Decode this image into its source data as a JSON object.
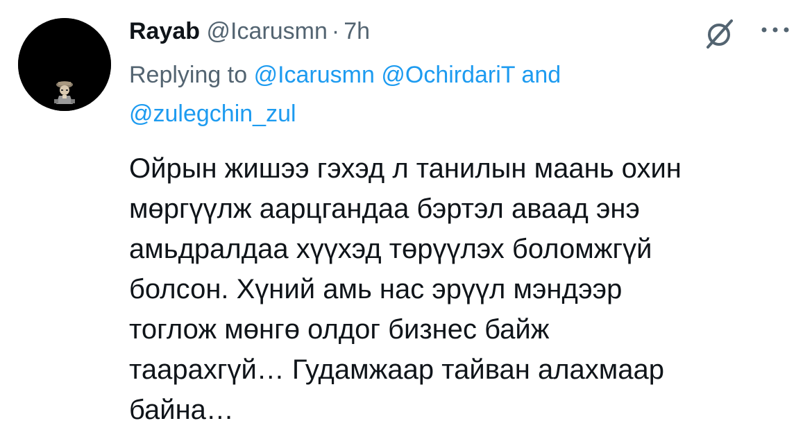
{
  "tweet": {
    "display_name": "Rayab",
    "handle": "@Icarusmn",
    "separator": "·",
    "time": "7h",
    "replying_prefix": "Replying to",
    "mentions": [
      "@Icarusmn",
      "@OchirdariT"
    ],
    "mentions_joiner": "and",
    "last_mention": "@zulegchin_zul",
    "text": "Ойрын жишээ гэхэд л танилын маань охин\nмөргүүлж аарцгандаа бэртэл аваад энэ\nамьдралдаа хүүхэд төрүүлэх боломжгүй\nболсон. Хүний амь нас эрүүл мэндээр\nтоглож мөнгө олдог бизнес байж\nтаарахгүй… Гудамжаар тайван алахмаар\nбайна…"
  },
  "icons": {
    "avatar": "user-avatar",
    "grok": "grok-icon",
    "more": "more-icon"
  },
  "colors": {
    "text_primary": "#0f1419",
    "text_secondary": "#536471",
    "link": "#1d9bf0",
    "background": "#ffffff"
  }
}
